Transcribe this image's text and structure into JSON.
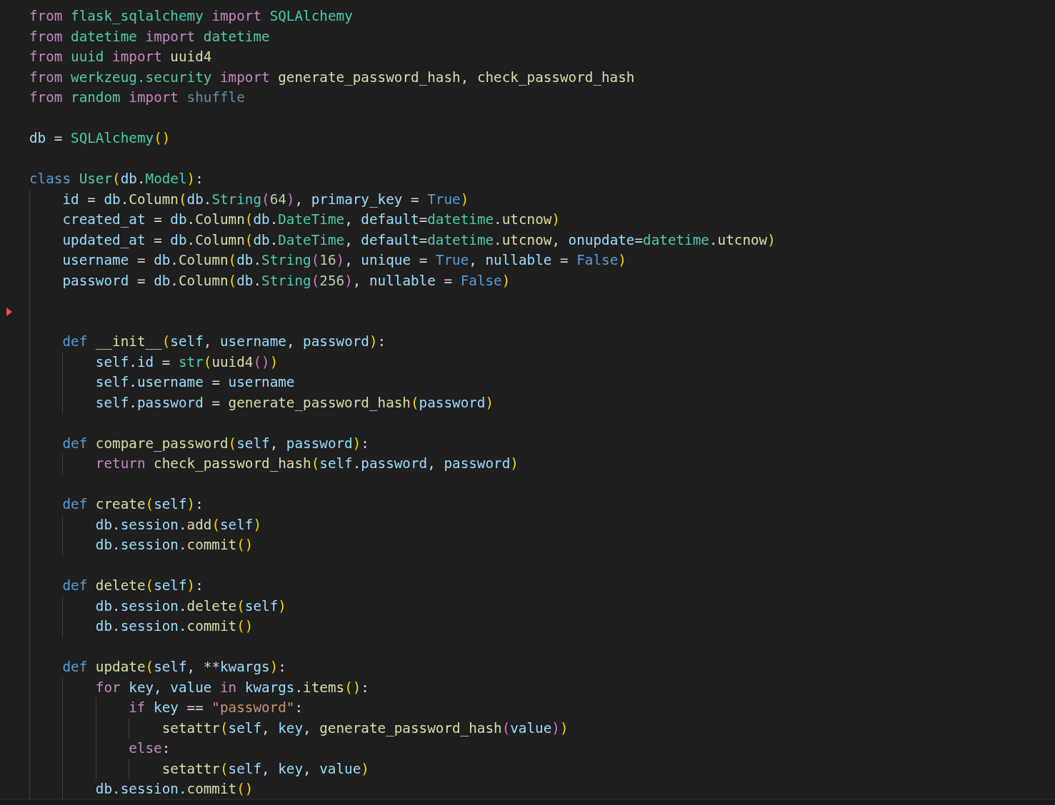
{
  "editor": {
    "lines": [
      {
        "kind": "code",
        "tokens": [
          {
            "text": "from ",
            "kind": "kw"
          },
          {
            "text": "flask_sqlalchemy ",
            "kind": "mod"
          },
          {
            "text": "import ",
            "kind": "kw"
          },
          {
            "text": "SQLAlchemy",
            "kind": "mod"
          }
        ]
      },
      {
        "kind": "code",
        "tokens": [
          {
            "text": "from ",
            "kind": "kw"
          },
          {
            "text": "datetime ",
            "kind": "mod"
          },
          {
            "text": "import ",
            "kind": "kw"
          },
          {
            "text": "datetime",
            "kind": "mod"
          }
        ]
      },
      {
        "kind": "code",
        "tokens": [
          {
            "text": "from ",
            "kind": "kw"
          },
          {
            "text": "uuid ",
            "kind": "mod"
          },
          {
            "text": "import ",
            "kind": "kw"
          },
          {
            "text": "uuid4",
            "kind": "fn"
          }
        ]
      },
      {
        "kind": "code",
        "tokens": [
          {
            "text": "from ",
            "kind": "kw"
          },
          {
            "text": "werkzeug.security ",
            "kind": "mod"
          },
          {
            "text": "import ",
            "kind": "kw"
          },
          {
            "text": "generate_password_hash",
            "kind": "fn"
          },
          {
            "text": ", ",
            "kind": "pl"
          },
          {
            "text": "check_password_hash",
            "kind": "fn"
          }
        ]
      },
      {
        "kind": "code",
        "tokens": [
          {
            "text": "from ",
            "kind": "kw"
          },
          {
            "text": "random ",
            "kind": "mod"
          },
          {
            "text": "import ",
            "kind": "kw"
          },
          {
            "text": "shuffle",
            "kind": "dim"
          }
        ]
      },
      {
        "kind": "blank"
      },
      {
        "kind": "code",
        "tokens": [
          {
            "text": "db ",
            "kind": "var"
          },
          {
            "text": "= ",
            "kind": "pl"
          },
          {
            "text": "SQLAlchemy",
            "kind": "mod"
          },
          {
            "text": "()",
            "kind": "b1"
          }
        ]
      },
      {
        "kind": "blank"
      },
      {
        "kind": "code",
        "tokens": [
          {
            "text": "class ",
            "kind": "st"
          },
          {
            "text": "User",
            "kind": "mod"
          },
          {
            "text": "(",
            "kind": "b1"
          },
          {
            "text": "db",
            "kind": "var"
          },
          {
            "text": ".",
            "kind": "pl"
          },
          {
            "text": "Model",
            "kind": "mod"
          },
          {
            "text": ")",
            "kind": "b1"
          },
          {
            "text": ":",
            "kind": "pl"
          }
        ],
        "children": [
          {
            "kind": "code",
            "tokens": [
              {
                "text": "id ",
                "kind": "var"
              },
              {
                "text": "= ",
                "kind": "pl"
              },
              {
                "text": "db",
                "kind": "var"
              },
              {
                "text": ".",
                "kind": "pl"
              },
              {
                "text": "Column",
                "kind": "fn"
              },
              {
                "text": "(",
                "kind": "b1"
              },
              {
                "text": "db",
                "kind": "var"
              },
              {
                "text": ".",
                "kind": "pl"
              },
              {
                "text": "String",
                "kind": "mod"
              },
              {
                "text": "(",
                "kind": "b2"
              },
              {
                "text": "64",
                "kind": "num"
              },
              {
                "text": ")",
                "kind": "b2"
              },
              {
                "text": ", ",
                "kind": "pl"
              },
              {
                "text": "primary_key ",
                "kind": "var"
              },
              {
                "text": "= ",
                "kind": "pl"
              },
              {
                "text": "True",
                "kind": "con"
              },
              {
                "text": ")",
                "kind": "b1"
              }
            ]
          },
          {
            "kind": "code",
            "tokens": [
              {
                "text": "created_at ",
                "kind": "var"
              },
              {
                "text": "= ",
                "kind": "pl"
              },
              {
                "text": "db",
                "kind": "var"
              },
              {
                "text": ".",
                "kind": "pl"
              },
              {
                "text": "Column",
                "kind": "fn"
              },
              {
                "text": "(",
                "kind": "b1"
              },
              {
                "text": "db",
                "kind": "var"
              },
              {
                "text": ".",
                "kind": "pl"
              },
              {
                "text": "DateTime",
                "kind": "mod"
              },
              {
                "text": ", ",
                "kind": "pl"
              },
              {
                "text": "default",
                "kind": "var"
              },
              {
                "text": "=",
                "kind": "pl"
              },
              {
                "text": "datetime",
                "kind": "mod"
              },
              {
                "text": ".",
                "kind": "pl"
              },
              {
                "text": "utcnow",
                "kind": "fn"
              },
              {
                "text": ")",
                "kind": "b1"
              }
            ]
          },
          {
            "kind": "code",
            "tokens": [
              {
                "text": "updated_at ",
                "kind": "var"
              },
              {
                "text": "= ",
                "kind": "pl"
              },
              {
                "text": "db",
                "kind": "var"
              },
              {
                "text": ".",
                "kind": "pl"
              },
              {
                "text": "Column",
                "kind": "fn"
              },
              {
                "text": "(",
                "kind": "b1"
              },
              {
                "text": "db",
                "kind": "var"
              },
              {
                "text": ".",
                "kind": "pl"
              },
              {
                "text": "DateTime",
                "kind": "mod"
              },
              {
                "text": ", ",
                "kind": "pl"
              },
              {
                "text": "default",
                "kind": "var"
              },
              {
                "text": "=",
                "kind": "pl"
              },
              {
                "text": "datetime",
                "kind": "mod"
              },
              {
                "text": ".",
                "kind": "pl"
              },
              {
                "text": "utcnow",
                "kind": "fn"
              },
              {
                "text": ", ",
                "kind": "pl"
              },
              {
                "text": "onupdate",
                "kind": "var"
              },
              {
                "text": "=",
                "kind": "pl"
              },
              {
                "text": "datetime",
                "kind": "mod"
              },
              {
                "text": ".",
                "kind": "pl"
              },
              {
                "text": "utcnow",
                "kind": "fn"
              },
              {
                "text": ")",
                "kind": "b1"
              }
            ]
          },
          {
            "kind": "code",
            "tokens": [
              {
                "text": "username ",
                "kind": "var"
              },
              {
                "text": "= ",
                "kind": "pl"
              },
              {
                "text": "db",
                "kind": "var"
              },
              {
                "text": ".",
                "kind": "pl"
              },
              {
                "text": "Column",
                "kind": "fn"
              },
              {
                "text": "(",
                "kind": "b1"
              },
              {
                "text": "db",
                "kind": "var"
              },
              {
                "text": ".",
                "kind": "pl"
              },
              {
                "text": "String",
                "kind": "mod"
              },
              {
                "text": "(",
                "kind": "b2"
              },
              {
                "text": "16",
                "kind": "num"
              },
              {
                "text": ")",
                "kind": "b2"
              },
              {
                "text": ", ",
                "kind": "pl"
              },
              {
                "text": "unique ",
                "kind": "var"
              },
              {
                "text": "= ",
                "kind": "pl"
              },
              {
                "text": "True",
                "kind": "con"
              },
              {
                "text": ", ",
                "kind": "pl"
              },
              {
                "text": "nullable ",
                "kind": "var"
              },
              {
                "text": "= ",
                "kind": "pl"
              },
              {
                "text": "False",
                "kind": "con"
              },
              {
                "text": ")",
                "kind": "b1"
              }
            ]
          },
          {
            "kind": "code",
            "tokens": [
              {
                "text": "password ",
                "kind": "var"
              },
              {
                "text": "= ",
                "kind": "pl"
              },
              {
                "text": "db",
                "kind": "var"
              },
              {
                "text": ".",
                "kind": "pl"
              },
              {
                "text": "Column",
                "kind": "fn"
              },
              {
                "text": "(",
                "kind": "b1"
              },
              {
                "text": "db",
                "kind": "var"
              },
              {
                "text": ".",
                "kind": "pl"
              },
              {
                "text": "String",
                "kind": "mod"
              },
              {
                "text": "(",
                "kind": "b2"
              },
              {
                "text": "256",
                "kind": "num"
              },
              {
                "text": ")",
                "kind": "b2"
              },
              {
                "text": ", ",
                "kind": "pl"
              },
              {
                "text": "nullable ",
                "kind": "var"
              },
              {
                "text": "= ",
                "kind": "pl"
              },
              {
                "text": "False",
                "kind": "con"
              },
              {
                "text": ")",
                "kind": "b1"
              }
            ]
          },
          {
            "kind": "blank"
          },
          {
            "kind": "blank"
          },
          {
            "kind": "code",
            "tokens": [
              {
                "text": "def ",
                "kind": "st"
              },
              {
                "text": "__init__",
                "kind": "fn"
              },
              {
                "text": "(",
                "kind": "b1"
              },
              {
                "text": "self",
                "kind": "var"
              },
              {
                "text": ", ",
                "kind": "pl"
              },
              {
                "text": "username",
                "kind": "var"
              },
              {
                "text": ", ",
                "kind": "pl"
              },
              {
                "text": "password",
                "kind": "var"
              },
              {
                "text": ")",
                "kind": "b1"
              },
              {
                "text": ":",
                "kind": "pl"
              }
            ],
            "children": [
              {
                "kind": "code",
                "tokens": [
                  {
                    "text": "self",
                    "kind": "var"
                  },
                  {
                    "text": ".",
                    "kind": "pl"
                  },
                  {
                    "text": "id ",
                    "kind": "var"
                  },
                  {
                    "text": "= ",
                    "kind": "pl"
                  },
                  {
                    "text": "str",
                    "kind": "mod"
                  },
                  {
                    "text": "(",
                    "kind": "b1"
                  },
                  {
                    "text": "uuid4",
                    "kind": "fn"
                  },
                  {
                    "text": "()",
                    "kind": "b2"
                  },
                  {
                    "text": ")",
                    "kind": "b1"
                  }
                ]
              },
              {
                "kind": "code",
                "tokens": [
                  {
                    "text": "self",
                    "kind": "var"
                  },
                  {
                    "text": ".",
                    "kind": "pl"
                  },
                  {
                    "text": "username ",
                    "kind": "var"
                  },
                  {
                    "text": "= ",
                    "kind": "pl"
                  },
                  {
                    "text": "username",
                    "kind": "var"
                  }
                ]
              },
              {
                "kind": "code",
                "tokens": [
                  {
                    "text": "self",
                    "kind": "var"
                  },
                  {
                    "text": ".",
                    "kind": "pl"
                  },
                  {
                    "text": "password ",
                    "kind": "var"
                  },
                  {
                    "text": "= ",
                    "kind": "pl"
                  },
                  {
                    "text": "generate_password_hash",
                    "kind": "fn"
                  },
                  {
                    "text": "(",
                    "kind": "b1"
                  },
                  {
                    "text": "password",
                    "kind": "var"
                  },
                  {
                    "text": ")",
                    "kind": "b1"
                  }
                ]
              }
            ]
          },
          {
            "kind": "blank"
          },
          {
            "kind": "code",
            "tokens": [
              {
                "text": "def ",
                "kind": "st"
              },
              {
                "text": "compare_password",
                "kind": "fn"
              },
              {
                "text": "(",
                "kind": "b1"
              },
              {
                "text": "self",
                "kind": "var"
              },
              {
                "text": ", ",
                "kind": "pl"
              },
              {
                "text": "password",
                "kind": "var"
              },
              {
                "text": ")",
                "kind": "b1"
              },
              {
                "text": ":",
                "kind": "pl"
              }
            ],
            "children": [
              {
                "kind": "code",
                "tokens": [
                  {
                    "text": "return ",
                    "kind": "kw"
                  },
                  {
                    "text": "check_password_hash",
                    "kind": "fn"
                  },
                  {
                    "text": "(",
                    "kind": "b1"
                  },
                  {
                    "text": "self",
                    "kind": "var"
                  },
                  {
                    "text": ".",
                    "kind": "pl"
                  },
                  {
                    "text": "password",
                    "kind": "var"
                  },
                  {
                    "text": ", ",
                    "kind": "pl"
                  },
                  {
                    "text": "password",
                    "kind": "var"
                  },
                  {
                    "text": ")",
                    "kind": "b1"
                  }
                ]
              }
            ]
          },
          {
            "kind": "blank"
          },
          {
            "kind": "code",
            "tokens": [
              {
                "text": "def ",
                "kind": "st"
              },
              {
                "text": "create",
                "kind": "fn"
              },
              {
                "text": "(",
                "kind": "b1"
              },
              {
                "text": "self",
                "kind": "var"
              },
              {
                "text": ")",
                "kind": "b1"
              },
              {
                "text": ":",
                "kind": "pl"
              }
            ],
            "children": [
              {
                "kind": "code",
                "tokens": [
                  {
                    "text": "db",
                    "kind": "var"
                  },
                  {
                    "text": ".",
                    "kind": "pl"
                  },
                  {
                    "text": "session",
                    "kind": "var"
                  },
                  {
                    "text": ".",
                    "kind": "pl"
                  },
                  {
                    "text": "add",
                    "kind": "fn"
                  },
                  {
                    "text": "(",
                    "kind": "b1"
                  },
                  {
                    "text": "self",
                    "kind": "var"
                  },
                  {
                    "text": ")",
                    "kind": "b1"
                  }
                ]
              },
              {
                "kind": "code",
                "tokens": [
                  {
                    "text": "db.session.",
                    "kind": "var"
                  },
                  {
                    "text": "commit",
                    "kind": "fn"
                  },
                  {
                    "text": "()",
                    "kind": "b1"
                  }
                ]
              }
            ]
          },
          {
            "kind": "blank"
          },
          {
            "kind": "code",
            "tokens": [
              {
                "text": "def ",
                "kind": "st"
              },
              {
                "text": "delete",
                "kind": "fn"
              },
              {
                "text": "(",
                "kind": "b1"
              },
              {
                "text": "self",
                "kind": "var"
              },
              {
                "text": ")",
                "kind": "b1"
              },
              {
                "text": ":",
                "kind": "pl"
              }
            ],
            "children": [
              {
                "kind": "code",
                "tokens": [
                  {
                    "text": "db",
                    "kind": "var"
                  },
                  {
                    "text": ".",
                    "kind": "pl"
                  },
                  {
                    "text": "session",
                    "kind": "var"
                  },
                  {
                    "text": ".",
                    "kind": "pl"
                  },
                  {
                    "text": "delete",
                    "kind": "fn"
                  },
                  {
                    "text": "(",
                    "kind": "b1"
                  },
                  {
                    "text": "self",
                    "kind": "var"
                  },
                  {
                    "text": ")",
                    "kind": "b1"
                  }
                ]
              },
              {
                "kind": "code",
                "tokens": [
                  {
                    "text": "db.session.",
                    "kind": "var"
                  },
                  {
                    "text": "commit",
                    "kind": "fn"
                  },
                  {
                    "text": "()",
                    "kind": "b1"
                  }
                ]
              }
            ]
          },
          {
            "kind": "blank"
          },
          {
            "kind": "code",
            "tokens": [
              {
                "text": "def ",
                "kind": "st"
              },
              {
                "text": "update",
                "kind": "fn"
              },
              {
                "text": "(",
                "kind": "b1"
              },
              {
                "text": "self",
                "kind": "var"
              },
              {
                "text": ", **",
                "kind": "pl"
              },
              {
                "text": "kwargs",
                "kind": "var"
              },
              {
                "text": ")",
                "kind": "b1"
              },
              {
                "text": ":",
                "kind": "pl"
              }
            ],
            "children": [
              {
                "kind": "code",
                "tokens": [
                  {
                    "text": "for ",
                    "kind": "kw"
                  },
                  {
                    "text": "key",
                    "kind": "var"
                  },
                  {
                    "text": ", ",
                    "kind": "pl"
                  },
                  {
                    "text": "value ",
                    "kind": "var"
                  },
                  {
                    "text": "in ",
                    "kind": "kw"
                  },
                  {
                    "text": "kwargs",
                    "kind": "var"
                  },
                  {
                    "text": ".",
                    "kind": "pl"
                  },
                  {
                    "text": "items",
                    "kind": "fn"
                  },
                  {
                    "text": "()",
                    "kind": "b1"
                  },
                  {
                    "text": ":",
                    "kind": "pl"
                  }
                ],
                "children": [
                  {
                    "kind": "code",
                    "tokens": [
                      {
                        "text": "if ",
                        "kind": "kw"
                      },
                      {
                        "text": "key ",
                        "kind": "var"
                      },
                      {
                        "text": "== ",
                        "kind": "pl"
                      },
                      {
                        "text": "\"password\"",
                        "kind": "str"
                      },
                      {
                        "text": ":",
                        "kind": "pl"
                      }
                    ],
                    "children": [
                      {
                        "kind": "code",
                        "tokens": [
                          {
                            "text": "setattr",
                            "kind": "fn"
                          },
                          {
                            "text": "(",
                            "kind": "b1"
                          },
                          {
                            "text": "self",
                            "kind": "var"
                          },
                          {
                            "text": ", ",
                            "kind": "pl"
                          },
                          {
                            "text": "key",
                            "kind": "var"
                          },
                          {
                            "text": ", ",
                            "kind": "pl"
                          },
                          {
                            "text": "generate_password_hash",
                            "kind": "fn"
                          },
                          {
                            "text": "(",
                            "kind": "b2"
                          },
                          {
                            "text": "value",
                            "kind": "var"
                          },
                          {
                            "text": ")",
                            "kind": "b2"
                          },
                          {
                            "text": ")",
                            "kind": "b1"
                          }
                        ]
                      }
                    ]
                  },
                  {
                    "kind": "code",
                    "tokens": [
                      {
                        "text": "else",
                        "kind": "kw"
                      },
                      {
                        "text": ":",
                        "kind": "pl"
                      }
                    ],
                    "children": [
                      {
                        "kind": "code",
                        "tokens": [
                          {
                            "text": "setattr",
                            "kind": "fn"
                          },
                          {
                            "text": "(",
                            "kind": "b1"
                          },
                          {
                            "text": "self",
                            "kind": "var"
                          },
                          {
                            "text": ", ",
                            "kind": "pl"
                          },
                          {
                            "text": "key",
                            "kind": "var"
                          },
                          {
                            "text": ", ",
                            "kind": "pl"
                          },
                          {
                            "text": "value",
                            "kind": "var"
                          },
                          {
                            "text": ")",
                            "kind": "b1"
                          }
                        ]
                      }
                    ]
                  }
                ]
              },
              {
                "kind": "code",
                "tokens": [
                  {
                    "text": "db.session.",
                    "kind": "var"
                  },
                  {
                    "text": "commit",
                    "kind": "fn"
                  },
                  {
                    "text": "()",
                    "kind": "b1"
                  }
                ]
              }
            ]
          }
        ]
      }
    ]
  }
}
